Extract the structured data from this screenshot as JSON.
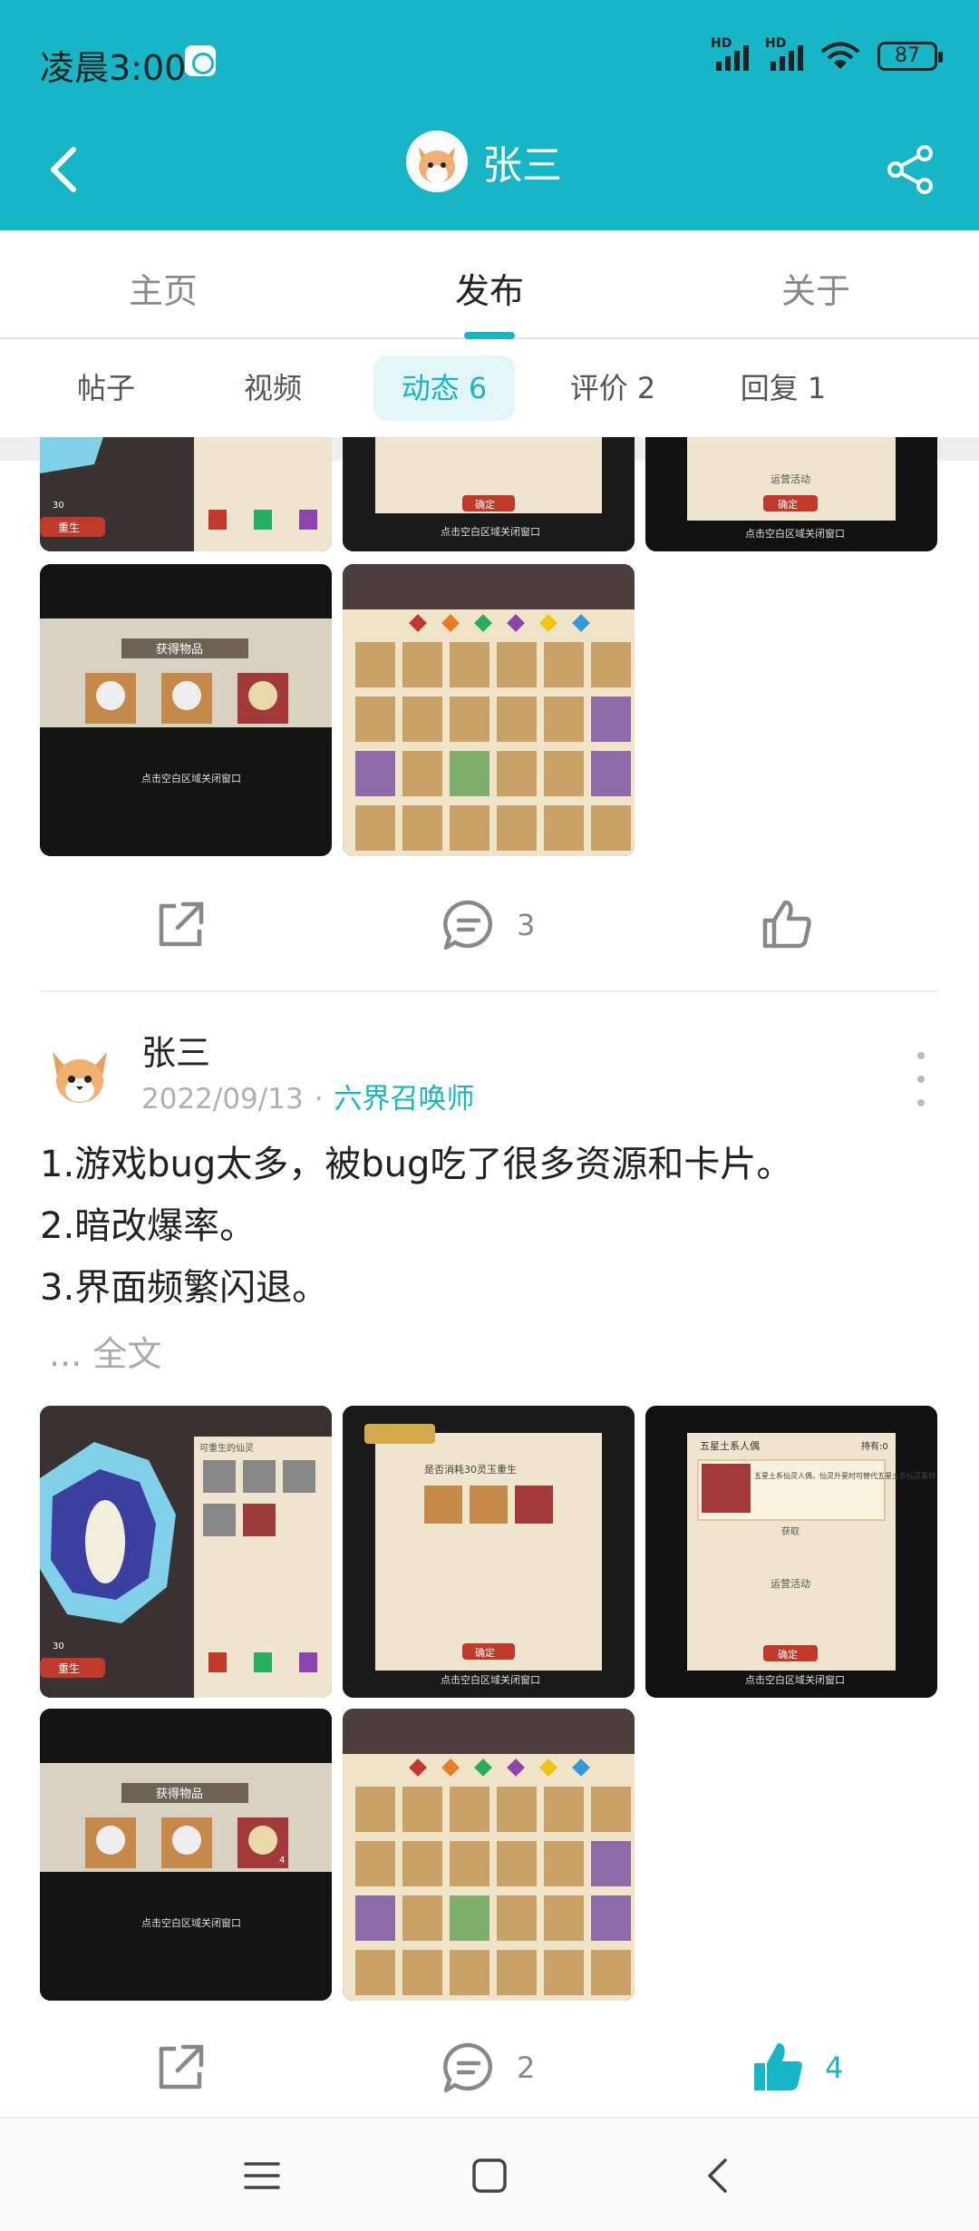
{
  "status_bar": {
    "time": "凌晨3:00",
    "signal_label": "HD",
    "battery": "87"
  },
  "header": {
    "username": "张三"
  },
  "tabs": [
    {
      "label": "主页"
    },
    {
      "label": "发布"
    },
    {
      "label": "关于"
    }
  ],
  "subtabs": [
    {
      "label": "帖子"
    },
    {
      "label": "视频"
    },
    {
      "label": "动态 6"
    },
    {
      "label": "评价 2"
    },
    {
      "label": "回复 1"
    }
  ],
  "game_ui_text": {
    "confirm": "确定",
    "close_hint": "点击空白区域关闭窗口",
    "reward_title": "获得物品",
    "rebirth": "重生",
    "rebirth_list": "可重生的仙灵",
    "rebirth_cost": "是否消耗30灵玉重生",
    "doll_title": "五星土系人偶",
    "doll_owned": "持有:0",
    "doll_desc": "五星土系仙灵人偶，仙灵升星时可替代五星土系仙灵素材",
    "doll_source": "获取",
    "doll_event": "运营活动",
    "currency": "30",
    "count_badge": "4"
  },
  "post1_actions": {
    "comments": "3",
    "likes": ""
  },
  "post2": {
    "author": "张三",
    "date": "2022/09/13",
    "separator": "·",
    "game": "六界召唤师",
    "lines": [
      "1.游戏bug太多，被bug吃了很多资源和卡片。",
      "2.暗改爆率。",
      "3.界面频繁闪退。"
    ],
    "more_label": "... 全文",
    "comments": "2",
    "likes": "4"
  },
  "colors": {
    "accent": "#17b6c6",
    "header_bg": "#17b6c6"
  },
  "icons": [
    "back-icon",
    "share-icon",
    "forward-icon",
    "comment-icon",
    "thumb-up-icon",
    "more-vertical-icon",
    "menu-icon",
    "home-icon",
    "nav-back-icon"
  ]
}
